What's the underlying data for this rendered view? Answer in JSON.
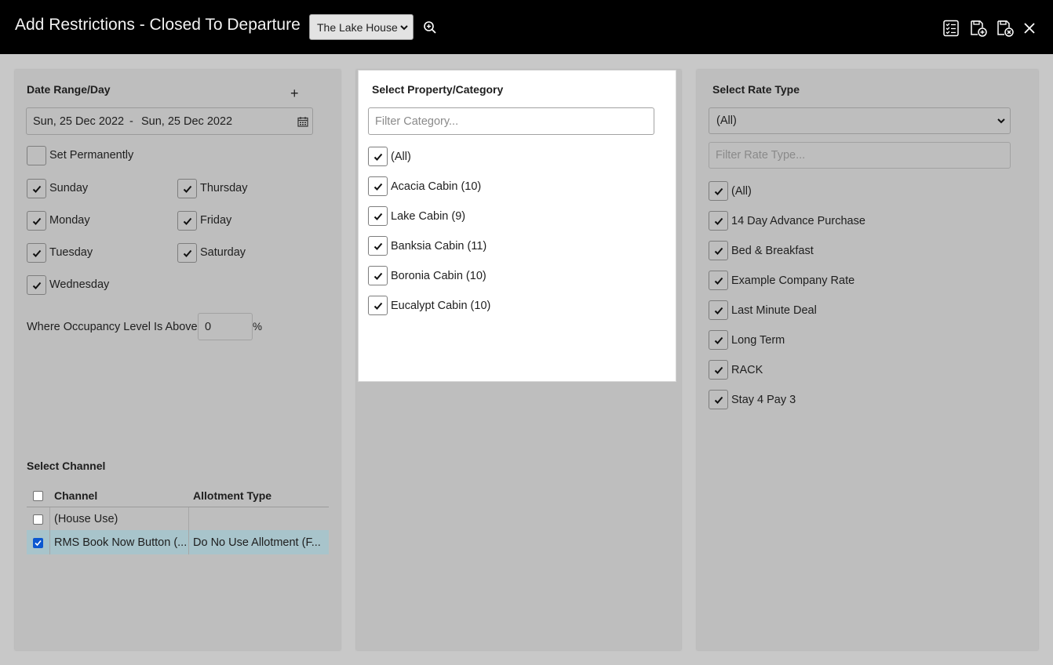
{
  "header": {
    "title": "Add Restrictions - Closed To Departure",
    "property_value": "The Lake House"
  },
  "date_panel": {
    "heading": "Date Range/Day",
    "add_symbol": "+",
    "start_date": "Sun, 25 Dec 2022",
    "separator": "-",
    "end_date": "Sun, 25 Dec 2022",
    "set_permanently": "Set Permanently",
    "days": [
      {
        "label": "Sunday",
        "checked": true
      },
      {
        "label": "Monday",
        "checked": true
      },
      {
        "label": "Tuesday",
        "checked": true
      },
      {
        "label": "Wednesday",
        "checked": true
      },
      {
        "label": "Thursday",
        "checked": true
      },
      {
        "label": "Friday",
        "checked": true
      },
      {
        "label": "Saturday",
        "checked": true
      }
    ],
    "occupancy_label": "Where Occupancy Level Is Above",
    "occupancy_value": "0",
    "occupancy_unit": "%"
  },
  "channel": {
    "heading": "Select Channel",
    "col_channel": "Channel",
    "col_allotment": "Allotment Type",
    "rows": [
      {
        "channel": "(House Use)",
        "allotment": "",
        "checked": false
      },
      {
        "channel": "RMS Book Now Button (...",
        "allotment": "Do No Use Allotment (F...",
        "checked": true
      }
    ]
  },
  "category": {
    "heading": "Select Property/Category",
    "filter_placeholder": "Filter Category...",
    "items": [
      {
        "label": "(All)",
        "checked": true
      },
      {
        "label": "Acacia Cabin (10)",
        "checked": true
      },
      {
        "label": "Lake Cabin (9)",
        "checked": true
      },
      {
        "label": "Banksia Cabin (11)",
        "checked": true
      },
      {
        "label": "Boronia Cabin (10)",
        "checked": true
      },
      {
        "label": "Eucalypt Cabin (10)",
        "checked": true
      }
    ]
  },
  "rate_type": {
    "heading": "Select Rate Type",
    "select_value": "(All)",
    "filter_placeholder": "Filter Rate Type...",
    "items": [
      {
        "label": "(All)",
        "checked": true
      },
      {
        "label": "14 Day Advance Purchase",
        "checked": true
      },
      {
        "label": "Bed & Breakfast",
        "checked": true
      },
      {
        "label": "Example Company Rate",
        "checked": true
      },
      {
        "label": "Last Minute Deal",
        "checked": true
      },
      {
        "label": "Long Term",
        "checked": true
      },
      {
        "label": "RACK",
        "checked": true
      },
      {
        "label": "Stay 4 Pay 3",
        "checked": true
      }
    ]
  },
  "icons": {
    "zoom": "zoom-in-icon",
    "toolbar": [
      "checklist-icon",
      "save-add-icon",
      "save-close-icon",
      "close-icon"
    ]
  }
}
